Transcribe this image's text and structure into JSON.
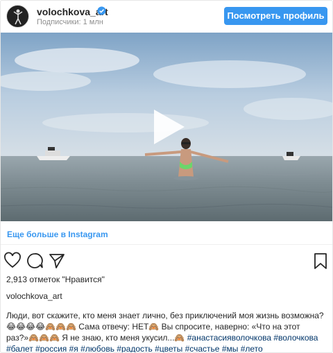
{
  "header": {
    "username": "volochkova_art",
    "followers": "Подписчики: 1 млн",
    "view_profile_label": "Посмотреть профиль"
  },
  "media": {
    "type": "video",
    "play_icon": "play-icon"
  },
  "links": {
    "more_instagram": "Еще больше в Instagram"
  },
  "actions": {
    "like_icon": "heart-icon",
    "comment_icon": "comment-icon",
    "share_icon": "share-icon",
    "save_icon": "bookmark-icon"
  },
  "likes_text": "2,913 отметок \"Нравится\"",
  "caption": {
    "user": "volochkova_art",
    "text": "Люди, вот скажите, кто меня знает лично, без приключений моя жизнь возможна?😂😂😂😂🙈🙈🙈 Сама отвечу: НЕТ🙈 Вы спросите, наверно: «Что на этот раз?»🙈🙈🙈 Я не знаю, кто меня укусил...🙈",
    "hashtags": "#анастасияволочкова #волочкова #балет #россия #я #любовь #радость #цветы #счастье #мы #лето"
  },
  "colors": {
    "accent": "#3897f0",
    "link": "#003569",
    "secondary_text": "#8e8e8e"
  }
}
